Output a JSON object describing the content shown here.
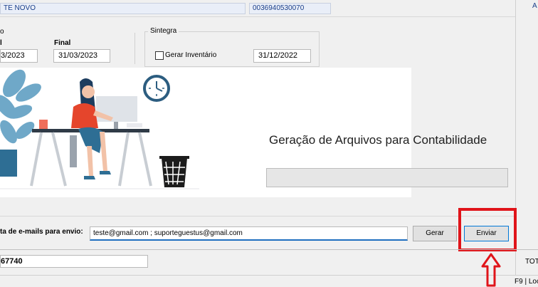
{
  "header": {
    "client_name": "TE NOVO",
    "client_code": "0036940530070",
    "right_char": "A"
  },
  "period": {
    "initial_label": "l",
    "final_label": "Final",
    "initial_value": "3/2023",
    "final_value": "31/03/2023",
    "group_fragment": "o"
  },
  "sintegra": {
    "title": "Sintegra",
    "inventory_label": "Gerar Inventário",
    "inventory_checked": false,
    "inventory_date": "31/12/2022"
  },
  "main": {
    "heading": "Geração de Arquivos para Contabilidade",
    "progress": 0
  },
  "email": {
    "label": "ta de e-mails para envio:",
    "value": "teste@gmail.com ; suporteguestus@gmail.com"
  },
  "buttons": {
    "generate": "Gerar",
    "send": "Enviar"
  },
  "footer": {
    "code_value": "67740",
    "total_label": "TOTA",
    "status_text": "F9 | Loc"
  },
  "colors": {
    "highlight": "#e0141a",
    "plant": "#6fa8c8",
    "shirt": "#e5452c"
  }
}
